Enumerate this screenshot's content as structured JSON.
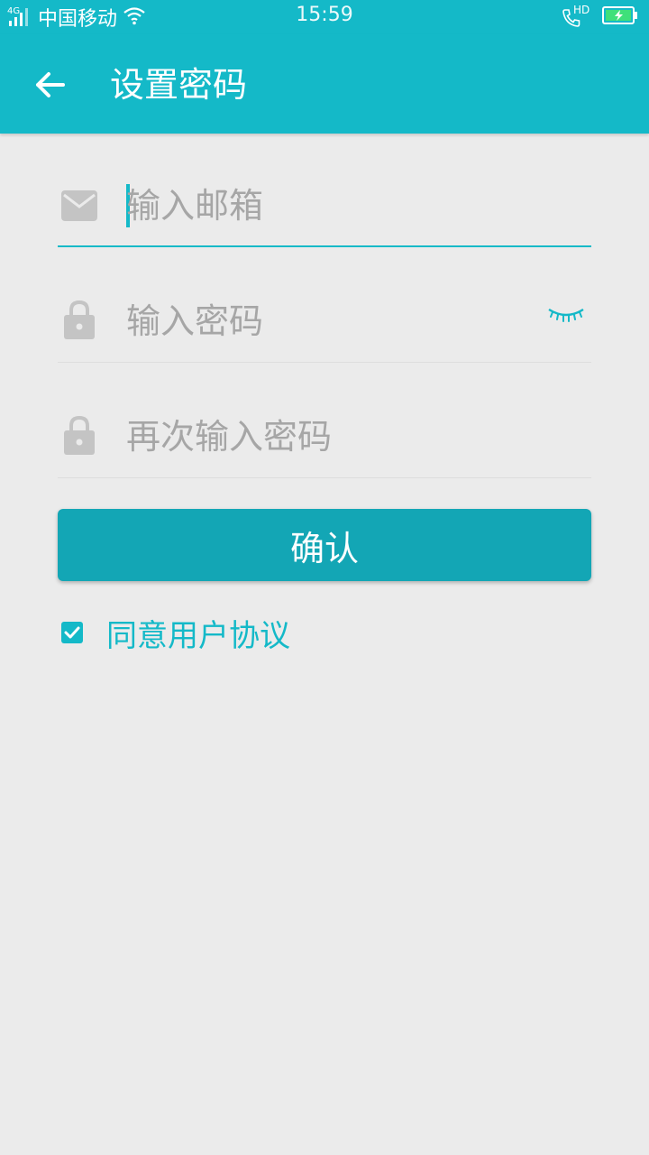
{
  "status_bar": {
    "network_type": "4G",
    "carrier": "中国移动",
    "time": "15:59",
    "call_badge": "HD",
    "icons": [
      "signal-icon",
      "wifi-icon",
      "hd-call-icon",
      "battery-charging-icon"
    ]
  },
  "app_bar": {
    "title": "设置密码",
    "back_icon": "arrow-left-icon"
  },
  "form": {
    "email": {
      "value": "",
      "placeholder": "输入邮箱",
      "icon": "mail-icon"
    },
    "password": {
      "value": "",
      "placeholder": "输入密码",
      "icon": "lock-icon",
      "toggle_icon": "eye-closed-icon"
    },
    "confirm_password": {
      "value": "",
      "placeholder": "再次输入密码",
      "icon": "lock-icon"
    }
  },
  "confirm_button": {
    "label": "确认"
  },
  "agreement": {
    "checked": true,
    "label": "同意用户协议"
  },
  "colors": {
    "accent": "#14b9c8",
    "button": "#13a6b5",
    "background": "#ebebeb",
    "icon_gray": "#c4c4c4",
    "placeholder": "#a6a6a6"
  }
}
